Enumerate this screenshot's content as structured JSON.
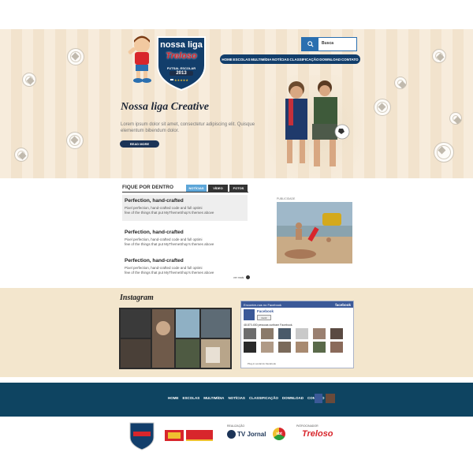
{
  "header": {
    "logo": {
      "line1": "nossa liga",
      "brand": "Treloso",
      "sub": "FUTSAL ESCOLAR",
      "year": "2013"
    },
    "search": {
      "value": "Busca"
    },
    "nav": [
      "HOME",
      "ESCOLAS",
      "MULTIMÍDIA",
      "NOTÍCIAS",
      "CLASSIFICAÇÃO",
      "DOWNLOAD",
      "CONTATO"
    ]
  },
  "hero": {
    "title": "Nossa liga Creative",
    "text": "Lorem ipsum dolor sit amet, consectetur adipiscing elit. Quisque elementum bibendum dolor.",
    "button": "READ MORE"
  },
  "news": {
    "heading": "FIQUE POR DENTRO",
    "tabs": [
      "NOTÍCIAS",
      "VÍDEO",
      "FOTOS"
    ],
    "items": [
      {
        "title": "Perfection, hand-crafted",
        "line1": "Pixel perfection, hand-crafted code and full optimi",
        "line2": "few of the things that put MyThemeShop's themes above"
      },
      {
        "title": "Perfection, hand-crafted",
        "line1": "Pixel perfection, hand-crafted code and full optimi",
        "line2": "few of the things that put MyThemeShop's themes above"
      },
      {
        "title": "Perfection, hand-crafted",
        "line1": "Pixel perfection, hand-crafted code and full optimi",
        "line2": "few of the things that put MyThemeShop's themes above"
      }
    ],
    "more": "ver mais",
    "ad_label": "PUBLICIDADE"
  },
  "instagram": {
    "title": "Instagram"
  },
  "facebook": {
    "header": "Encontre-nos no Facebook",
    "brand": "facebook",
    "page_name": "Facebook",
    "like": "Curtir",
    "count": "48.870.450 pessoas curtiram Facebook.",
    "plugin": "Plug-in social do Facebook"
  },
  "footer": {
    "nav": [
      "HOME",
      "ESCOLAS",
      "MULTIMÍDIA",
      "NOTÍCIAS",
      "CLASSIFICAÇÃO",
      "DOWNLOAD",
      "CONTATO"
    ],
    "realizacao": "REALIZAÇÃO",
    "patrocinador": "PATROCINADOR",
    "sponsors": {
      "sistema": "Sistema Jornal do Commercio",
      "tv": "TV Jornal",
      "sbt": "sbt",
      "treloso": "Treloso"
    }
  },
  "colors": {
    "navy": "#123e6b",
    "footer": "#0e4461",
    "accent": "#2a6fb0",
    "facebook": "#3b5998",
    "treloso_red": "#d8262c"
  }
}
